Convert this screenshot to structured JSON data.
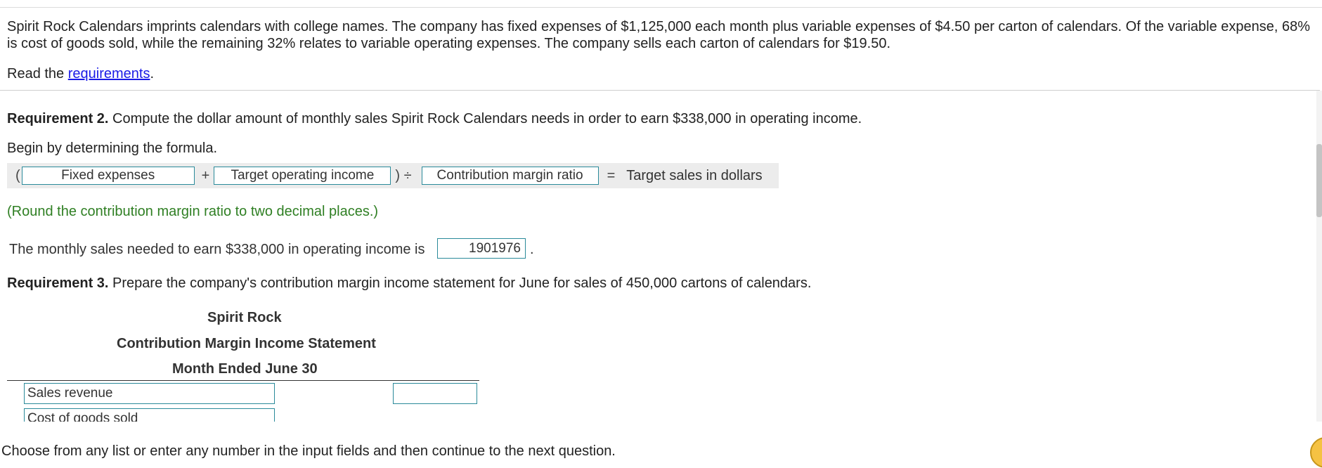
{
  "problem": {
    "text": "Spirit Rock Calendars imprints calendars with college names. The company has fixed expenses of $1,125,000 each month plus variable expenses of $4.50 per carton of calendars. Of the variable expense, 68% is cost of goods sold, while the remaining 32% relates to variable operating expenses. The company sells each carton of calendars for $19.50.",
    "read_prefix": "Read the ",
    "read_link": "requirements",
    "read_suffix": "."
  },
  "req2": {
    "label": "Requirement 2.",
    "text": " Compute the dollar amount of monthly sales Spirit Rock Calendars needs in order to earn $338,000 in operating income.",
    "begin": "Begin by determining the formula.",
    "formula": {
      "open_paren": "(",
      "box1": "Fixed expenses",
      "plus": "+",
      "box2": "Target operating income",
      "close_div": ") ÷",
      "box3": "Contribution margin ratio",
      "equals": "=",
      "result": "Target sales in dollars"
    },
    "hint": "(Round the contribution margin ratio to two decimal places.)",
    "answer_text": "The monthly sales needed to earn $338,000 in operating income is",
    "answer_value": "1901976",
    "answer_suffix": "."
  },
  "req3": {
    "label": "Requirement 3.",
    "text": " Prepare the company's contribution margin income statement for June for sales of 450,000 cartons of calendars.",
    "statement": {
      "company": "Spirit Rock",
      "title": "Contribution Margin Income Statement",
      "period": "Month Ended June 30",
      "line1_label": "Sales revenue",
      "line1_value": "",
      "line2_label": "Cost of goods sold"
    }
  },
  "footer": "Choose from any list or enter any number in the input fields and then continue to the next question.",
  "colors": {
    "link": "#1a1ae6",
    "hint_green": "#2f7f23",
    "input_border": "#2a8a9a",
    "help_button": "#f5c243"
  }
}
